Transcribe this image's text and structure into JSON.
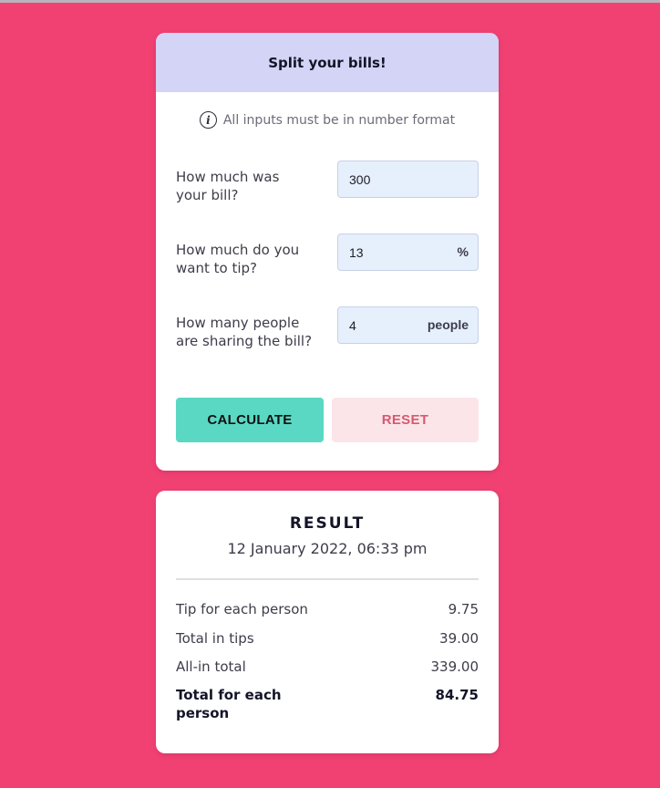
{
  "calculator": {
    "title": "Split your bills!",
    "info_text": "All inputs must be in number format",
    "info_icon": "i",
    "fields": [
      {
        "label": "How much was your bill?",
        "value": "300",
        "unit": ""
      },
      {
        "label": "How much do you want to tip?",
        "value": "13",
        "unit": "%"
      },
      {
        "label": "How many people are sharing the bill?",
        "value": "4",
        "unit": "people"
      }
    ],
    "calculate_label": "CALCULATE",
    "reset_label": "RESET"
  },
  "result": {
    "title": "RESULT",
    "date": "12 January 2022, 06:33 pm",
    "rows": [
      {
        "label": "Tip for each person",
        "value": "9.75"
      },
      {
        "label": "Total in tips",
        "value": "39.00"
      },
      {
        "label": "All-in total",
        "value": "339.00"
      },
      {
        "label": "Total for each person",
        "value": "84.75"
      }
    ]
  },
  "colors": {
    "background": "#f14173",
    "header": "#d3d4f6",
    "calculate_button": "#5ad8c3",
    "reset_button": "#fbe5e9",
    "reset_text": "#d65a70",
    "input_background": "#e6effc"
  }
}
